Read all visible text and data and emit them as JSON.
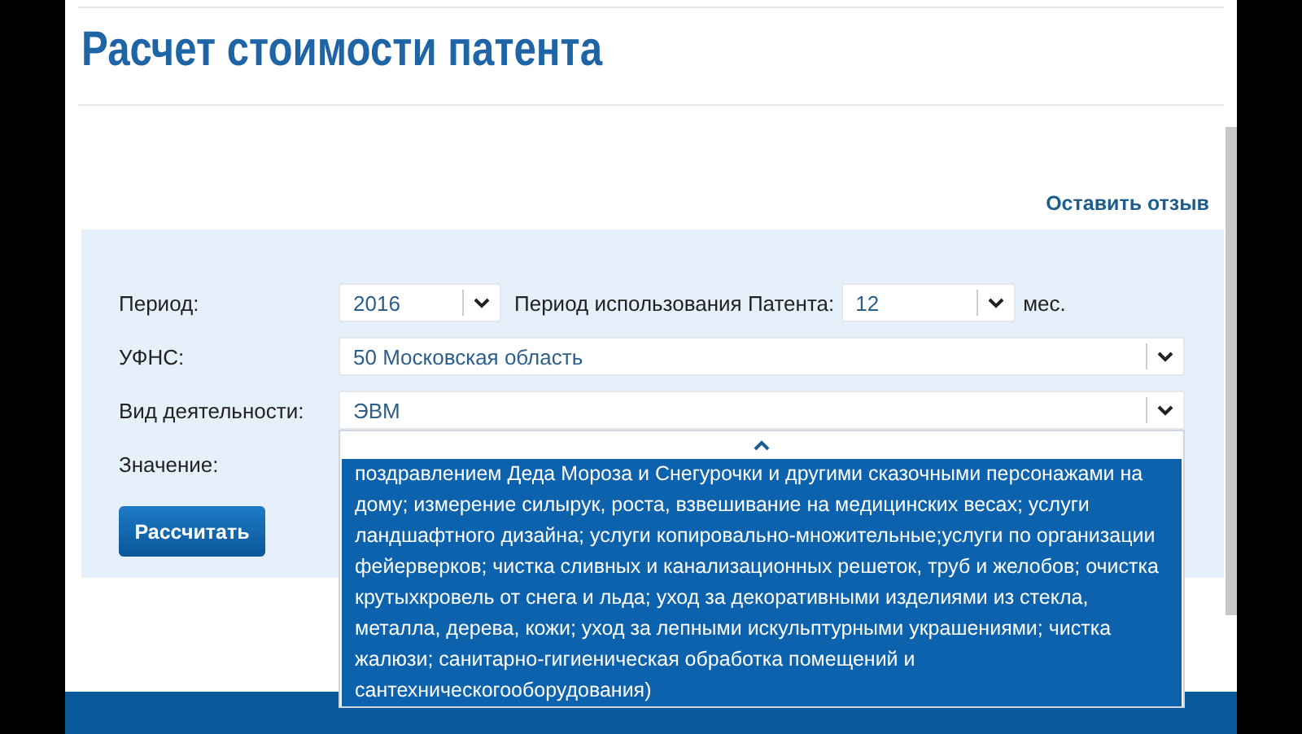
{
  "title": "Расчет стоимости патента",
  "feedback_link": "Оставить отзыв",
  "form": {
    "period": {
      "label": "Период:",
      "value": "2016"
    },
    "patent_period": {
      "label": "Период использования Патента:",
      "value": "12",
      "unit": "мес."
    },
    "ufns": {
      "label": "УФНС:",
      "value": "50 Московская область"
    },
    "activity": {
      "label": "Вид деятельности:",
      "value": "ЭВМ",
      "expanded": true,
      "options": [
        {
          "text": "поздравлением Деда Мороза и Снегурочки и другими сказочными персонажами на дому; измерение силырук, роста, взвешивание на медицинских весах; услуги ландшафтного дизайна; услуги копировально-множительные;услуги по организации фейерверков; чистка сливных и канализационных решеток, труб и желобов; очистка крутыхкровель от снега и льда; уход за декоративными изделиями из стекла, металла, дерева, кожи; уход за лепными искульптурными украшениями; чистка жалюзи; санитарно-гигиеническая обработка помещений и сантехническогооборудования)",
          "selected": true
        }
      ]
    },
    "value_label": "Значение:",
    "calculate_button": "Рассчитать"
  }
}
